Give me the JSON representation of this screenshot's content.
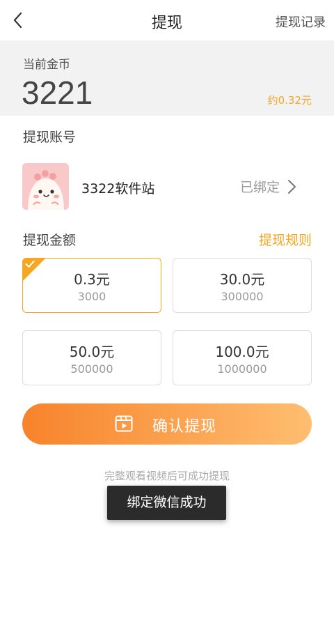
{
  "nav": {
    "title": "提现",
    "record_label": "提现记录",
    "back_icon": "chevron-left-icon"
  },
  "balance": {
    "label": "当前金币",
    "coins": "3221",
    "approx": "约0.32元"
  },
  "account": {
    "section_label": "提现账号",
    "name": "3322软件站",
    "status": "已绑定",
    "chevron_icon": "chevron-right-icon",
    "avatar_icon": "cartoon-avatar"
  },
  "amount_section": {
    "label": "提现金额",
    "rules_label": "提现规则",
    "options": [
      {
        "amount": "0.3元",
        "cost": "3000",
        "selected": true
      },
      {
        "amount": "30.0元",
        "cost": "300000",
        "selected": false
      },
      {
        "amount": "50.0元",
        "cost": "500000",
        "selected": false
      },
      {
        "amount": "100.0元",
        "cost": "1000000",
        "selected": false
      }
    ]
  },
  "confirm": {
    "label": "确认提现",
    "icon": "video-play-icon"
  },
  "hint": "完整观看视频后可成功提现",
  "toast": "绑定微信成功",
  "colors": {
    "accent": "#f5a623",
    "button_gradient_start": "#f7832b",
    "button_gradient_end": "#ffbe70",
    "toast_bg": "#2b2b2b"
  }
}
